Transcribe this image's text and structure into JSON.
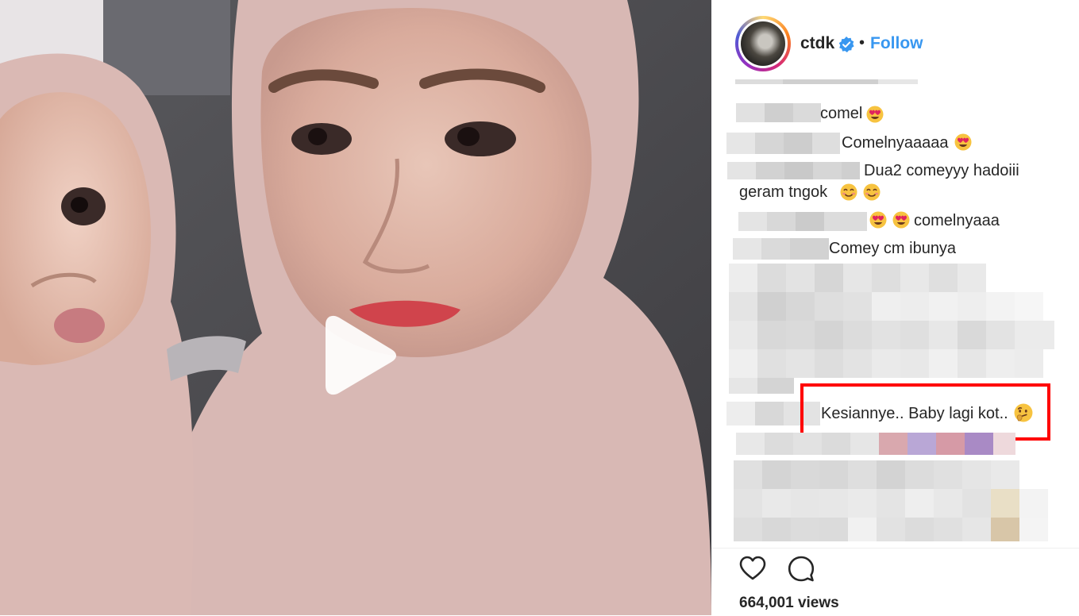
{
  "header": {
    "username": "ctdk",
    "separator": "•",
    "follow_label": "Follow"
  },
  "comments": [
    {
      "text": "comel",
      "emojis": [
        "heart-eyes"
      ]
    },
    {
      "text": "Comelnyaaaaa",
      "emojis": [
        "heart-eyes"
      ]
    },
    {
      "text_line1": "Dua2 comeyyy hadoiii",
      "text_line2": "geram tngok",
      "emojis": [
        "smiling",
        "smiling"
      ]
    },
    {
      "text": "comelnyaaa",
      "emojis_before": [
        "heart-eyes",
        "heart-eyes"
      ]
    },
    {
      "text": "Comey cm ibunya"
    },
    {
      "text": "Kesiannye.. Baby lagi kot..",
      "emojis": [
        "thinking"
      ],
      "highlighted": true
    }
  ],
  "actions": {
    "like_icon": "heart-outline-icon",
    "comment_icon": "comment-bubble-icon",
    "views_label": "664,001 views"
  },
  "media": {
    "play_icon": "play-icon"
  },
  "colors": {
    "follow": "#3897f0",
    "verified": "#3897f0",
    "highlight_border": "#ff0000"
  }
}
